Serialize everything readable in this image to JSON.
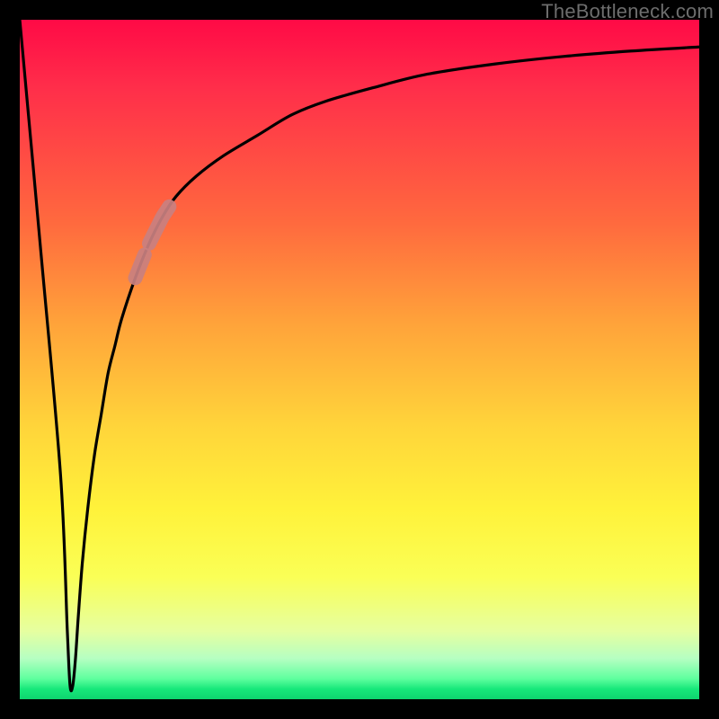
{
  "watermark": "TheBottleneck.com",
  "colors": {
    "frame": "#000000",
    "curve": "#000000",
    "highlight": "#c98080",
    "gradient_top": "#ff0a46",
    "gradient_bottom": "#0ed46e"
  },
  "chart_data": {
    "type": "line",
    "title": "",
    "xlabel": "",
    "ylabel": "",
    "xlim": [
      0,
      100
    ],
    "ylim": [
      0,
      100
    ],
    "grid": false,
    "legend": false,
    "series": [
      {
        "name": "bottleneck-curve",
        "x": [
          0,
          3,
          6,
          7,
          7.4,
          7.8,
          8.2,
          8.6,
          9.2,
          10,
          11,
          12,
          13,
          14,
          15,
          17,
          19,
          21,
          23,
          26,
          30,
          35,
          40,
          45,
          52,
          60,
          70,
          80,
          90,
          100
        ],
        "y": [
          100,
          67,
          33,
          10,
          2,
          2,
          6,
          12,
          20,
          28,
          36,
          42,
          48,
          52,
          56,
          62,
          67,
          71,
          74,
          77,
          80,
          83,
          86,
          88,
          90,
          92,
          93.5,
          94.6,
          95.4,
          96
        ]
      }
    ],
    "highlight_segment": {
      "series": "bottleneck-curve",
      "x_range": [
        17,
        22
      ],
      "style": "thick-rose"
    },
    "background_gradient": {
      "direction": "vertical",
      "stops": [
        {
          "pos": 0.0,
          "hex": "#ff0a46"
        },
        {
          "pos": 0.1,
          "hex": "#ff2e4a"
        },
        {
          "pos": 0.3,
          "hex": "#ff6a3e"
        },
        {
          "pos": 0.45,
          "hex": "#ffa43a"
        },
        {
          "pos": 0.6,
          "hex": "#ffd53a"
        },
        {
          "pos": 0.72,
          "hex": "#fff23a"
        },
        {
          "pos": 0.82,
          "hex": "#faff56"
        },
        {
          "pos": 0.9,
          "hex": "#e6ffa0"
        },
        {
          "pos": 0.94,
          "hex": "#b6ffc2"
        },
        {
          "pos": 0.97,
          "hex": "#5eff9e"
        },
        {
          "pos": 0.985,
          "hex": "#17e87a"
        },
        {
          "pos": 1.0,
          "hex": "#0ed46e"
        }
      ]
    }
  }
}
